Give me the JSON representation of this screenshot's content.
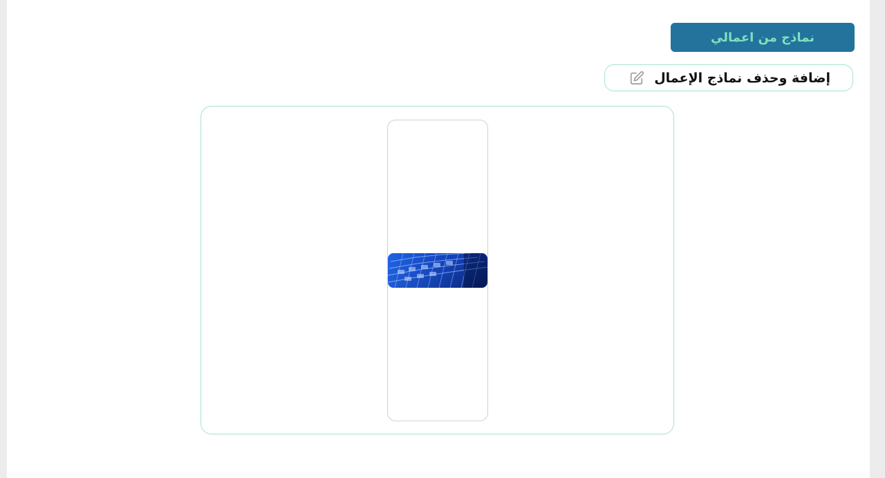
{
  "header": {
    "title": "نماذج من اعمالي"
  },
  "actions": {
    "edit_label": "إضافة وحذف نماذج الإعمال",
    "edit_icon": "edit-icon"
  },
  "gallery": {
    "items": [
      {
        "thumbnail": "keyboard-photo"
      }
    ]
  },
  "colors": {
    "header_bg": "#23739c",
    "header_text": "#7fe0c0",
    "border_accent": "#a6e2d3"
  }
}
